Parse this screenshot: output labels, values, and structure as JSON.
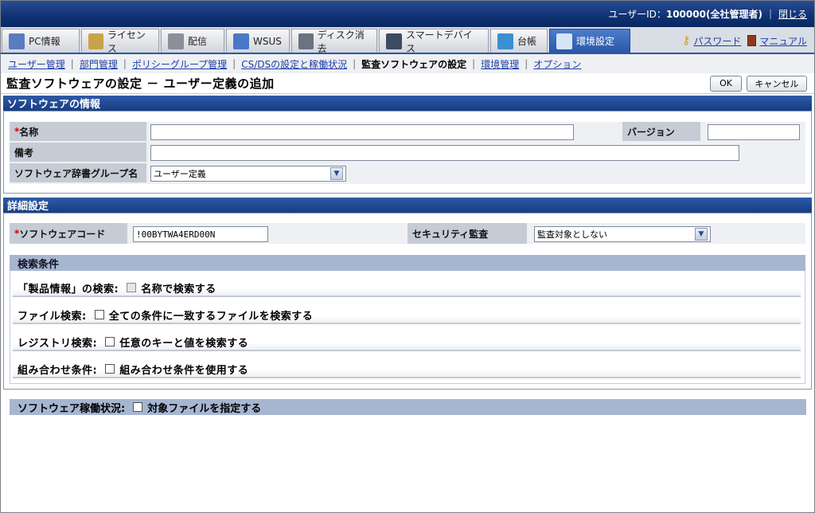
{
  "header": {
    "user_label": "ユーザーID：",
    "user_value": "100000(全社管理者)",
    "logout": "閉じる"
  },
  "tabs": [
    {
      "label": "PC情報",
      "icon": "pc-icon",
      "color": "#5a7bbf"
    },
    {
      "label": "ライセンス",
      "icon": "license-icon",
      "color": "#c9a34a"
    },
    {
      "label": "配信",
      "icon": "distribution-icon",
      "color": "#8a8f98"
    },
    {
      "label": "WSUS",
      "icon": "wsus-icon",
      "color": "#4a78c9"
    },
    {
      "label": "ディスク消去",
      "icon": "disk-erase-icon",
      "color": "#6b7280"
    },
    {
      "label": "スマートデバイス",
      "icon": "smartphone-icon",
      "color": "#3d4b63"
    },
    {
      "label": "台帳",
      "icon": "ledger-icon",
      "color": "#3a8fd1"
    },
    {
      "label": "環境設定",
      "icon": "settings-tools-icon",
      "color": "#d6e4f7"
    }
  ],
  "top_links": {
    "password": "パスワード",
    "manual": "マニュアル"
  },
  "subnav": [
    {
      "label": "ユーザー管理",
      "current": false
    },
    {
      "label": "部門管理",
      "current": false
    },
    {
      "label": "ポリシーグループ管理",
      "current": false
    },
    {
      "label": "CS/DSの設定と稼働状況",
      "current": false
    },
    {
      "label": "監査ソフトウェアの設定",
      "current": true
    },
    {
      "label": "環境管理",
      "current": false
    },
    {
      "label": "オプション",
      "current": false
    }
  ],
  "page": {
    "title": "監査ソフトウェアの設定 － ユーザー定義の追加",
    "ok": "OK",
    "cancel": "キャンセル"
  },
  "software_info": {
    "header": "ソフトウェアの情報",
    "required_mark": "*",
    "name_label": "名称",
    "name_value": "",
    "version_label": "バージョン",
    "version_value": "",
    "note_label": "備考",
    "note_value": "",
    "group_label": "ソフトウェア辞書グループ名",
    "group_value": "ユーザー定義"
  },
  "details": {
    "header": "詳細設定",
    "code_label": "ソフトウェアコード",
    "code_value": "!00BYTWA4ERD00N",
    "security_label": "セキュリティ監査",
    "security_value": "監査対象としない",
    "search_header": "検索条件",
    "criteria": [
      {
        "label": "「製品情報」の検索:",
        "option": "名称で検索する",
        "disabled": true
      },
      {
        "label": "ファイル検索:",
        "option": "全ての条件に一致するファイルを検索する",
        "disabled": false
      },
      {
        "label": "レジストリ検索:",
        "option": "任意のキーと値を検索する",
        "disabled": false
      },
      {
        "label": "組み合わせ条件:",
        "option": "組み合わせ条件を使用する",
        "disabled": false
      }
    ],
    "operation_label": "ソフトウェア稼働状況:",
    "operation_option": "対象ファイルを指定する"
  }
}
